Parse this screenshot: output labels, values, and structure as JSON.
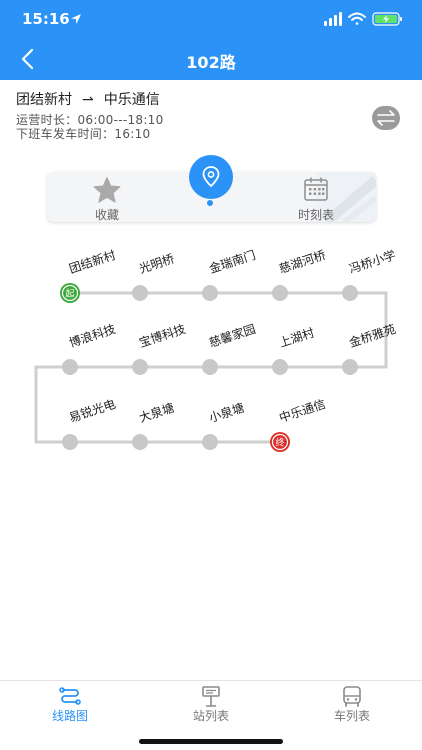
{
  "status_bar": {
    "time": "15:16"
  },
  "nav": {
    "title": "102路"
  },
  "route": {
    "from": "团结新村",
    "arrow": "⇀",
    "to": "中乐通信",
    "operating_hours": "运营时长：06:00---18:10",
    "last_departure": "下班车发车时间：16:10"
  },
  "actions": {
    "favorite": "收藏",
    "schedule": "时刻表"
  },
  "stops": [
    {
      "name": "团结新村",
      "badge": "起"
    },
    {
      "name": "光明桥"
    },
    {
      "name": "金瑞南门"
    },
    {
      "name": "慈湖河桥"
    },
    {
      "name": "冯桥小学"
    },
    {
      "name": "金桥雅苑"
    },
    {
      "name": "上湖村"
    },
    {
      "name": "慈馨家园"
    },
    {
      "name": "宝博科技"
    },
    {
      "name": "博浪科技"
    },
    {
      "name": "易锐光电"
    },
    {
      "name": "大泉塘"
    },
    {
      "name": "小泉塘"
    },
    {
      "name": "中乐通信",
      "badge": "终"
    }
  ],
  "tabs": [
    {
      "label": "线路图",
      "active": true
    },
    {
      "label": "站列表",
      "active": false
    },
    {
      "label": "车列表",
      "active": false
    }
  ],
  "colors": {
    "primary": "#2b93f7",
    "start": "#3aa83a",
    "end": "#d9302b",
    "stop": "#c8c8c8"
  }
}
